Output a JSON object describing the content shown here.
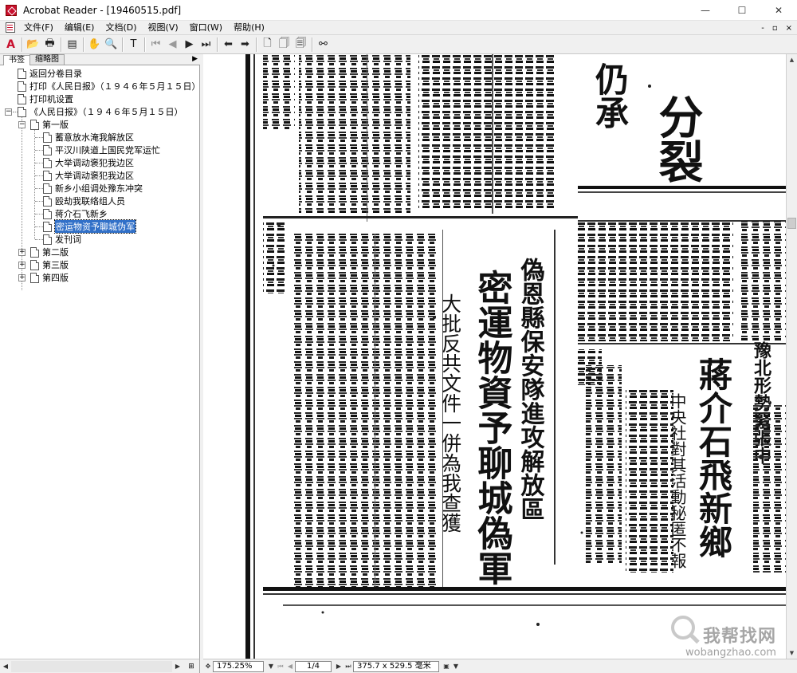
{
  "window": {
    "title": "Acrobat Reader - [19460515.pdf]",
    "controls": [
      "—",
      "☐",
      "✕"
    ]
  },
  "menubar": {
    "items": [
      "文件(F)",
      "编辑(E)",
      "文档(D)",
      "视图(V)",
      "窗口(W)",
      "帮助(H)"
    ],
    "doc_controls": [
      "-",
      "▫",
      "×"
    ]
  },
  "panel": {
    "tabs": [
      "书签",
      "缩略图"
    ]
  },
  "bookmarks": {
    "top": [
      "返回分卷目录",
      "打印《人民日报》（１９４６年５月１５日）",
      "打印机设置"
    ],
    "root": "《人民日报》（１９４６年５月１５日）",
    "edition1": "第一版",
    "articles": [
      "蓄意放水淹我解放区",
      "平汉川陕道上国民党军运忙",
      "大举调动褒犯我边区",
      "大举调动褒犯我边区",
      "新乡小组调处豫东冲突",
      "殴劫我联络组人员",
      "蒋介石飞新乡",
      "密运物资予聊城伪军",
      "发刊词"
    ],
    "selected_index": 7,
    "other_editions": [
      "第二版",
      "第三版",
      "第四版"
    ]
  },
  "statusbar": {
    "zoom": "175.25%",
    "page": "1/4",
    "size": "375.7 x 529.5 毫米"
  },
  "document": {
    "headlines": {
      "h1": "密運物資予聊城偽軍",
      "h2": "大批反共文件一併為我查獲",
      "h3": "蔣介石飛新鄉",
      "h4": "中央社對其活動秘匿不報",
      "h5": "豫北形勢緊張中",
      "h6": "偽恩縣保安隊進攻解放區",
      "h7": "分裂",
      "h8": "仍承"
    }
  },
  "watermark": {
    "text": "我帮找网",
    "url": "wobangzhao.com"
  }
}
